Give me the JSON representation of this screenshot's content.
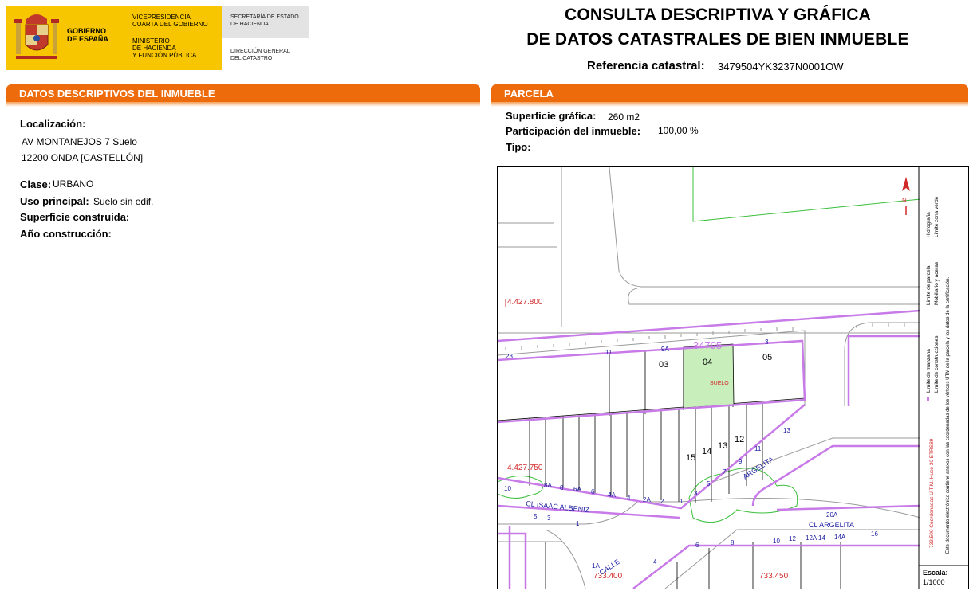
{
  "header": {
    "gobierno": [
      "GOBIERNO",
      "DE ESPAÑA"
    ],
    "vicepresidencia": [
      "VICEPRESIDENCIA",
      "CUARTA DEL GOBIERNO"
    ],
    "ministerio": [
      "MINISTERIO",
      "DE HACIENDA",
      "Y FUNCIÓN PÚBLICA"
    ],
    "secretaria": [
      "SECRETARÍA DE ESTADO",
      "DE HACIENDA"
    ],
    "direccion": [
      "DIRECCIÓN GENERAL",
      "DEL CATASTRO"
    ],
    "title_line1": "CONSULTA DESCRIPTIVA Y GRÁFICA",
    "title_line2": "DE DATOS CATASTRALES DE BIEN INMUEBLE",
    "ref_label": "Referencia catastral:",
    "ref_value": "3479504YK3237N0001OW"
  },
  "datos": {
    "header_prefix": "DATOS DESCRIPTIVOS DEL ",
    "header_bold": "INMUEBLE",
    "localizacion_label": "Localización:",
    "address_line1": "AV MONTANEJOS 7 Suelo",
    "address_line2": "12200 ONDA [CASTELLÓN]",
    "clase_label": "Clase:",
    "clase_value": "URBANO",
    "uso_label": "Uso principal:",
    "uso_value": "Suelo sin edif.",
    "superficie_construida_label": "Superficie construida:",
    "anio_label": "Año construcción:"
  },
  "parcela": {
    "header": "PARCELA",
    "superficie_label": "Superficie gráfica:",
    "superficie_value": "260 m2",
    "participacion_label": "Participación del inmueble:",
    "participacion_value": "100,00 %",
    "tipo_label": "Tipo:"
  },
  "map": {
    "coords": {
      "y1": "4.427.800",
      "y2": "4.427.750",
      "x1": "733.400",
      "x2": "733.450"
    },
    "block_label": "34795",
    "parcel_labels": [
      "03",
      "04",
      "05",
      "15",
      "14",
      "13",
      "12"
    ],
    "suelo_label": "SUELO",
    "street_numbers": [
      "23",
      "11",
      "9A",
      "3",
      "10",
      "8A",
      "8",
      "6A",
      "6",
      "4A",
      "4",
      "2A",
      "2",
      "1",
      "3",
      "5",
      "7",
      "9",
      "11",
      "13",
      "5",
      "3",
      "1",
      "20A",
      "6",
      "8",
      "10",
      "12",
      "12A",
      "14",
      "14A",
      "16",
      "1A",
      "4"
    ],
    "street_names": [
      "CL  ISAAC  ALBENIZ",
      "ARGELITA",
      "CL   ARGELITA",
      "CALLE"
    ],
    "legend": [
      "Limite de manzana",
      "Limite de parcela",
      "Hidrografia",
      "Limite de construcciones",
      "Mobiliario y aceras",
      "Limite zona verde",
      "733.500 Coordenadas U.T.M. Huso 30 ETRS89",
      "Este documento electrónico contiene anexos con las coordenadas de los vértices UTM de la parcela y los datos de la certificación."
    ],
    "scale_label": "Escala:",
    "scale_value": "1/1000",
    "colors": {
      "manzana": "#c77ae8",
      "zona_verde": "#3bbf3b",
      "coords": "#d12a2a",
      "parcel_fill": "#c7eebb",
      "street_text": "#1a1aa0"
    }
  }
}
